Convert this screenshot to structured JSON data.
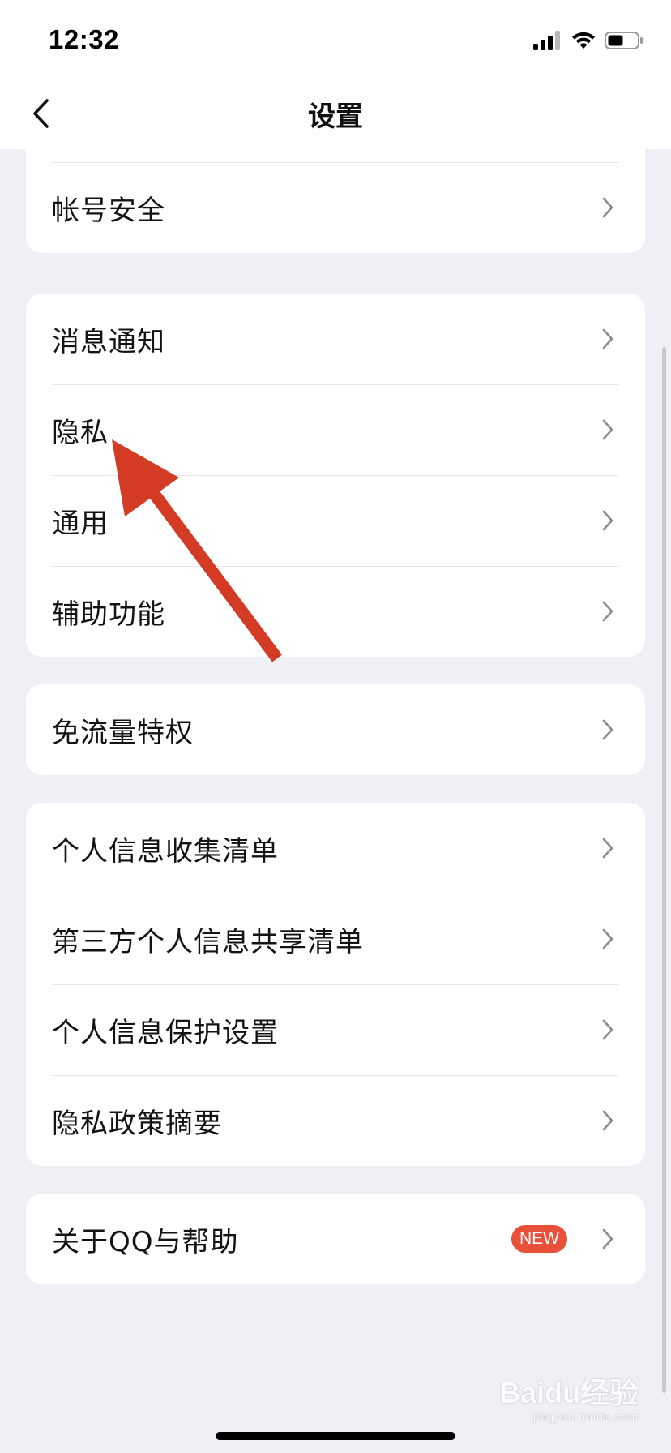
{
  "status_bar": {
    "time": "12:32"
  },
  "nav": {
    "title": "设置",
    "back_icon": "chevron-left-icon"
  },
  "groups": [
    {
      "items": [
        {
          "label": "帐号安全"
        }
      ]
    },
    {
      "items": [
        {
          "label": "消息通知"
        },
        {
          "label": "隐私"
        },
        {
          "label": "通用"
        },
        {
          "label": "辅助功能"
        }
      ]
    },
    {
      "items": [
        {
          "label": "免流量特权"
        }
      ]
    },
    {
      "items": [
        {
          "label": "个人信息收集清单"
        },
        {
          "label": "第三方个人信息共享清单"
        },
        {
          "label": "个人信息保护设置"
        },
        {
          "label": "隐私政策摘要"
        }
      ]
    },
    {
      "items": [
        {
          "label": "关于QQ与帮助",
          "badge": "NEW"
        }
      ]
    }
  ],
  "annotation": {
    "arrow_color": "#d43b24",
    "points_to": "隐私"
  },
  "watermark": {
    "brand": "Baidu经验",
    "url": "jingyan.baidu.com"
  },
  "colors": {
    "background": "#eff0f5",
    "card": "#ffffff",
    "badge": "#e8503a",
    "chevron": "#8a8a8f"
  }
}
